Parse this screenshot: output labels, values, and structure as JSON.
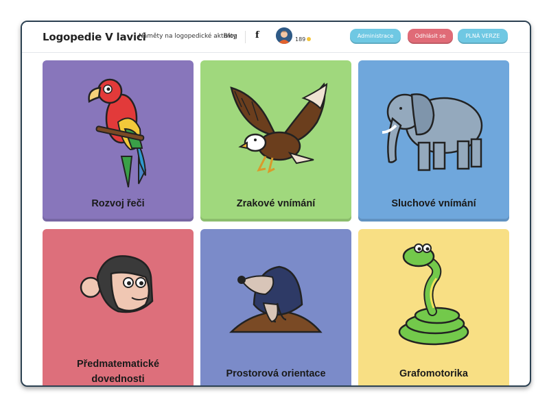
{
  "header": {
    "logo": "Logopedie V lavici",
    "nav_activities": "Náměty na logopedické aktivity",
    "nav_blog": "Blog",
    "facebook_icon": "f",
    "credits": "189",
    "btn_admin": "Administrace",
    "btn_logout": "Odhlásit se",
    "btn_full": "PLNÁ VERZE"
  },
  "colors": {
    "purple": "#8876bb",
    "green": "#a0d87d",
    "blue": "#6fa7dc",
    "pink": "#dd6f7b",
    "indigo": "#7b8bc9",
    "yellow": "#f8df84",
    "button_cyan": "#6fc8e3",
    "button_red": "#e06b77"
  },
  "cards": [
    {
      "label": "Rozvoj řeči",
      "icon": "parrot-icon"
    },
    {
      "label": "Zrakové vnímání",
      "icon": "eagle-icon"
    },
    {
      "label": "Sluchové vnímání",
      "icon": "elephant-icon"
    },
    {
      "label_line1": "Předmatematické",
      "label_line2": "dovednosti",
      "icon": "monkey-icon"
    },
    {
      "label": "Prostorová orientace",
      "icon": "mole-icon"
    },
    {
      "label": "Grafomotorika",
      "icon": "snake-icon"
    }
  ]
}
